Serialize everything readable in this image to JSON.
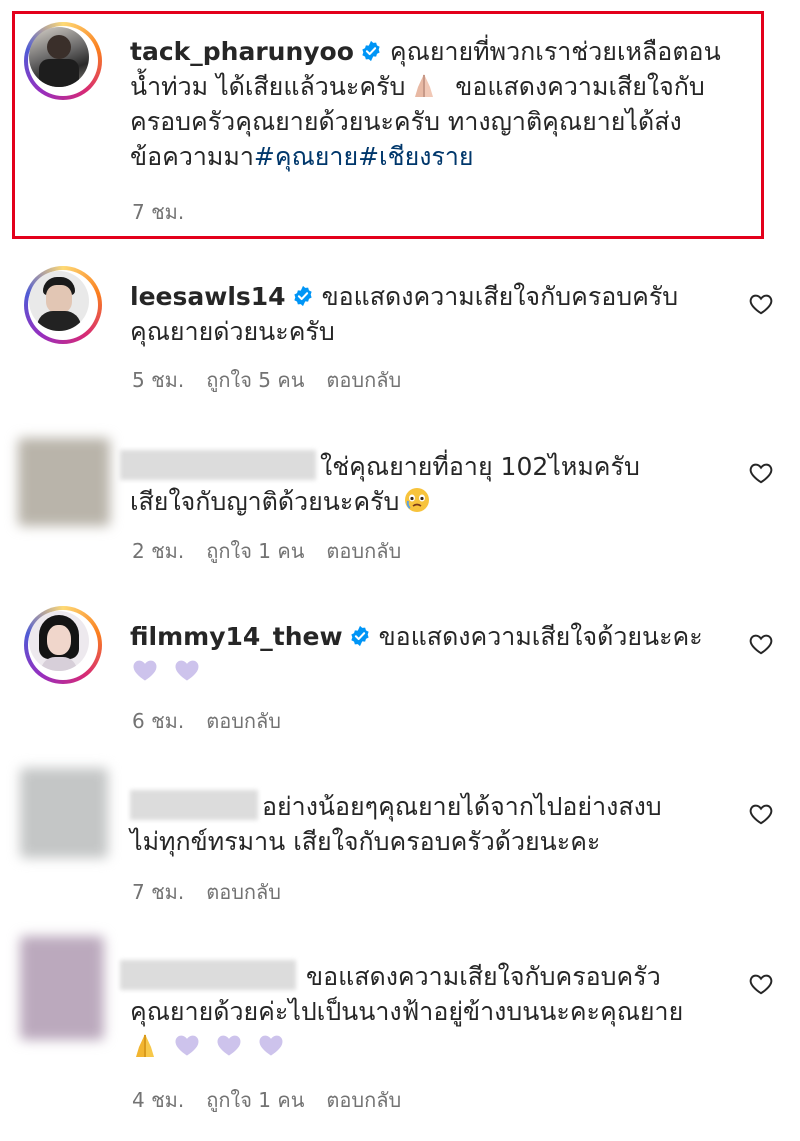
{
  "comments": [
    {
      "username": "tack_pharunyoo",
      "verified": true,
      "text_line1": "คุณยายที่พวกเราช่วยเหลือตอน",
      "text_line2": "น้ำท่วม ได้เสียแล้วนะครับ",
      "text_line3": "ขอแสดงความเสียใจกับ",
      "text_line4": "ครอบครัวคุณยายด้วยนะครับ ทางญาติคุณยายได้ส่ง",
      "text_line5": "ข้อความมา",
      "hashtag1": "#คุณยาย",
      "hashtag2": "#เชียงราย",
      "time": "7 ชม.",
      "highlighted": true
    },
    {
      "username": "leesawls14",
      "verified": true,
      "text_line1": "ขอแสดงความเสียใจกับครอบครับ",
      "text_line2": "คุณยายด่วยนะครับ",
      "time": "5 ชม.",
      "likes": "ถูกใจ 5 คน",
      "reply": "ตอบกลับ"
    },
    {
      "username_hidden": true,
      "text_line1": "ใช่คุณยายที่อายุ 102ไหมครับ",
      "text_line2": "เสียใจกับญาติด้วยนะครับ",
      "time": "2 ชม.",
      "likes": "ถูกใจ 1 คน",
      "reply": "ตอบกลับ"
    },
    {
      "username": "filmmy14_thew",
      "verified": true,
      "text_line1": "ขอแสดงความเสียใจด้วยนะคะ",
      "time": "6 ชม.",
      "reply": "ตอบกลับ"
    },
    {
      "username_hidden": true,
      "text_line1": "อย่างน้อยๆคุณยายได้จากไปอย่างสงบ",
      "text_line2": "ไม่ทุกข์ทรมาน เสียใจกับครอบครัวด้วยนะคะ",
      "time": "7 ชม.",
      "reply": "ตอบกลับ"
    },
    {
      "username_hidden": true,
      "text_line1": "ขอแสดงความเสียใจกับครอบครัว",
      "text_line2": "คุณยายด้วยค่ะไปเป็นนางฟ้าอยู่ข้างบนนะคะคุณยาย",
      "time": "4 ชม.",
      "likes": "ถูกใจ 1 คน",
      "reply": "ตอบกลับ"
    }
  ],
  "colors": {
    "highlight_border": "#e3001b",
    "verified_badge": "#0095f6",
    "hashtag": "#00376b",
    "meta_text": "#737373",
    "heart_purple": "#c9bfea"
  },
  "icons": [
    "heart-outline-icon",
    "verified-badge-icon",
    "purple-heart-emoji",
    "folded-hands-emoji",
    "crying-face-emoji"
  ]
}
